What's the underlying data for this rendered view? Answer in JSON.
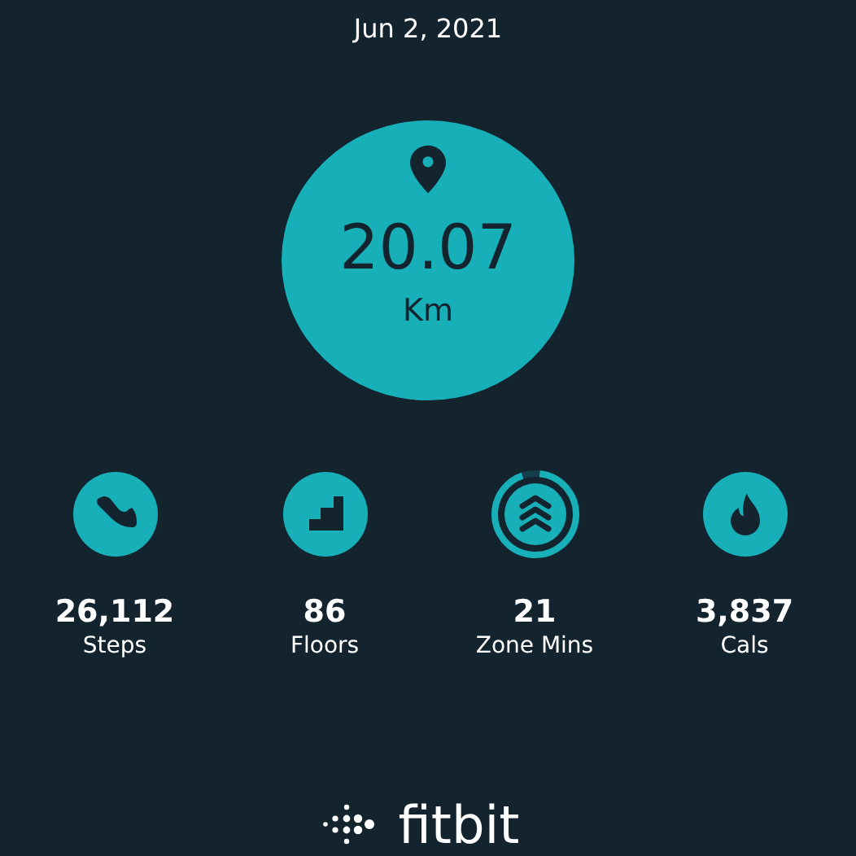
{
  "date": "Jun 2, 2021",
  "distance": {
    "value": "20.07",
    "unit": "Km"
  },
  "stats": [
    {
      "kind": "steps",
      "value": "26,112",
      "label": "Steps"
    },
    {
      "kind": "floors",
      "value": "86",
      "label": "Floors"
    },
    {
      "kind": "zone",
      "value": "21",
      "label": "Zone Mins",
      "level": 0.93
    },
    {
      "kind": "cals",
      "value": "3,837",
      "label": "Cals"
    }
  ],
  "brand": "fitbit"
}
